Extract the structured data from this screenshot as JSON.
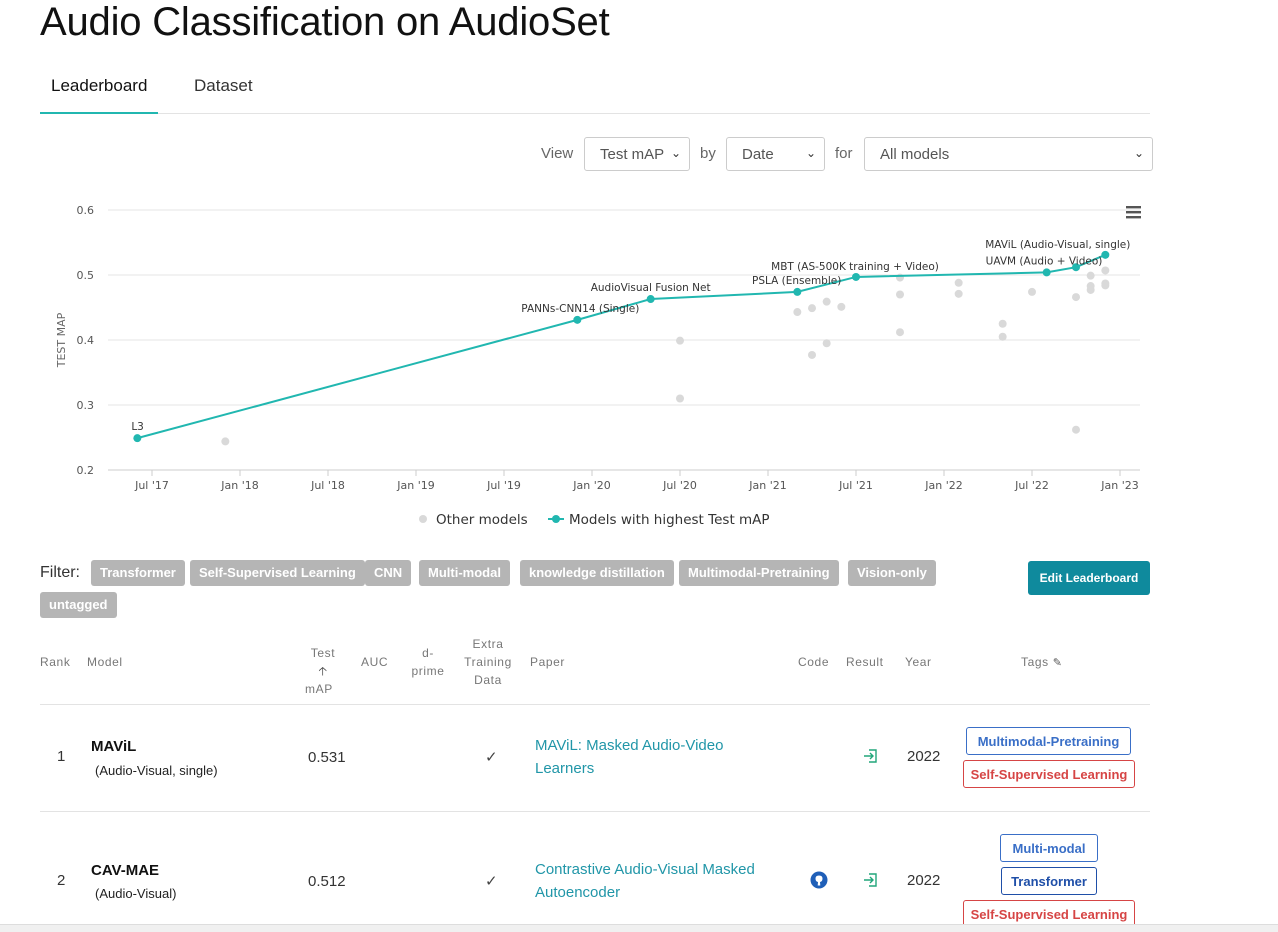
{
  "page": {
    "title": "Audio Classification on AudioSet"
  },
  "tabs": [
    "Leaderboard",
    "Dataset"
  ],
  "controls": {
    "view_label": "View",
    "view_value": "Test mAP",
    "by_label": "by",
    "by_value": "Date",
    "for_label": "for",
    "for_value": "All models"
  },
  "chart_data": {
    "type": "scatter",
    "ylabel": "TEST MAP",
    "ylim": [
      0.2,
      0.6
    ],
    "yticks": [
      "0.6",
      "0.5",
      "0.4",
      "0.3",
      "0.2"
    ],
    "xticks": [
      "Jul '17",
      "Jan '18",
      "Jul '18",
      "Jan '19",
      "Jul '19",
      "Jan '20",
      "Jul '20",
      "Jan '21",
      "Jul '21",
      "Jan '22",
      "Jul '22",
      "Jan '23"
    ],
    "legend": [
      "Other models",
      "Models with highest Test mAP"
    ],
    "best_series": [
      {
        "date": "2017-06",
        "value": 0.249,
        "label": "L3"
      },
      {
        "date": "2019-12",
        "value": 0.431,
        "label": "PANNs-CNN14 (Single)"
      },
      {
        "date": "2020-05",
        "value": 0.463,
        "label": "AudioVisual Fusion Net"
      },
      {
        "date": "2021-03",
        "value": 0.474,
        "label": "PSLA (Ensemble)"
      },
      {
        "date": "2021-07",
        "value": 0.497,
        "label": "MBT (AS-500K training + Video)"
      },
      {
        "date": "2022-08",
        "value": 0.504,
        "label": "UAVM (Audio + Video)"
      },
      {
        "date": "2022-10",
        "value": 0.512,
        "label": ""
      },
      {
        "date": "2022-12",
        "value": 0.531,
        "label": "MAViL (Audio-Visual, single)"
      }
    ],
    "other_series": [
      {
        "date": "2017-12",
        "value": 0.244
      },
      {
        "date": "2020-07",
        "value": 0.399
      },
      {
        "date": "2020-07",
        "value": 0.31
      },
      {
        "date": "2021-03",
        "value": 0.443
      },
      {
        "date": "2021-04",
        "value": 0.449
      },
      {
        "date": "2021-05",
        "value": 0.459
      },
      {
        "date": "2021-04",
        "value": 0.377
      },
      {
        "date": "2021-05",
        "value": 0.395
      },
      {
        "date": "2021-06",
        "value": 0.451
      },
      {
        "date": "2021-10",
        "value": 0.496
      },
      {
        "date": "2021-10",
        "value": 0.47
      },
      {
        "date": "2021-10",
        "value": 0.412
      },
      {
        "date": "2022-02",
        "value": 0.488
      },
      {
        "date": "2022-02",
        "value": 0.471
      },
      {
        "date": "2022-05",
        "value": 0.425
      },
      {
        "date": "2022-05",
        "value": 0.405
      },
      {
        "date": "2022-07",
        "value": 0.474
      },
      {
        "date": "2022-10",
        "value": 0.466
      },
      {
        "date": "2022-10",
        "value": 0.262
      },
      {
        "date": "2022-11",
        "value": 0.477
      },
      {
        "date": "2022-11",
        "value": 0.499
      },
      {
        "date": "2022-11",
        "value": 0.483
      },
      {
        "date": "2022-12",
        "value": 0.507
      },
      {
        "date": "2022-12",
        "value": 0.487
      },
      {
        "date": "2022-12",
        "value": 0.484
      }
    ]
  },
  "filter": {
    "label": "Filter:",
    "tags": [
      "Transformer",
      "Self-Supervised Learning",
      "CNN",
      "Multi-modal",
      "knowledge distillation",
      "Multimodal-Pretraining",
      "Vision-only",
      "untagged"
    ],
    "edit_button": "Edit Leaderboard"
  },
  "table": {
    "headers": {
      "rank": "Rank",
      "model": "Model",
      "test_map_1": "Test",
      "test_map_2": "mAP",
      "auc": "AUC",
      "dprime_1": "d-",
      "dprime_2": "prime",
      "extra_1": "Extra",
      "extra_2": "Training",
      "extra_3": "Data",
      "paper": "Paper",
      "code": "Code",
      "result": "Result",
      "year": "Year",
      "tags": "Tags"
    },
    "rows": [
      {
        "rank": "1",
        "model": "MAViL",
        "model_sub": "(Audio-Visual, single)",
        "test_map": "0.531",
        "extra": "✓",
        "paper_line1": "MAViL: Masked Audio-Video",
        "paper_line2": "Learners",
        "year": "2022",
        "tags": [
          "Multimodal-Pretraining",
          "Self-Supervised Learning"
        ]
      },
      {
        "rank": "2",
        "model": "CAV-MAE",
        "model_sub": "(Audio-Visual)",
        "test_map": "0.512",
        "extra": "✓",
        "paper_line1": "Contrastive Audio-Visual Masked",
        "paper_line2": "Autoencoder",
        "year": "2022",
        "tags": [
          "Multi-modal",
          "Transformer",
          "Self-Supervised Learning"
        ]
      }
    ]
  },
  "colors": {
    "accent": "#21b7b0",
    "link": "#2196a8",
    "edit_button": "#0f8a9d",
    "other_dots": "#d9d9d9"
  }
}
